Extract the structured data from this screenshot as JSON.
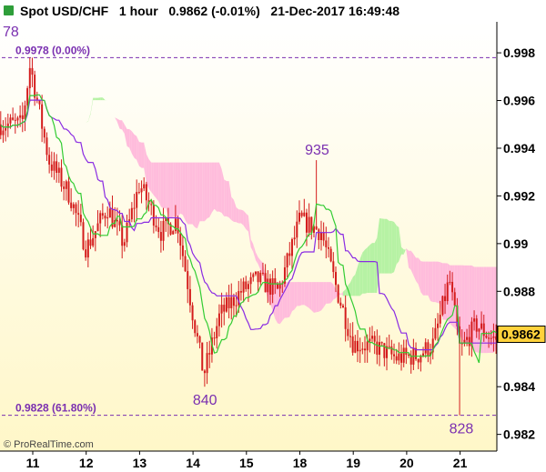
{
  "title": {
    "instrument": "Spot USD/CHF",
    "period": "1 hour",
    "last": "0.9862",
    "change": "(-0.01%)",
    "datetime": "21-Dec-2017 16:49:48"
  },
  "copyright": "© ProRealTime.com",
  "colors": {
    "candle": "#d41c1c",
    "tenkan": "#33cc33",
    "kijun": "#8a2be2",
    "kumo_bull": "#b6f2a4",
    "kumo_bear": "#ffbcdc",
    "background_top": "#ffffff",
    "background_bottom": "#fff7c8",
    "annotation": "#7a2fb0"
  },
  "chart_data": {
    "type": "candlestick",
    "x_ticks": [
      "11",
      "12",
      "13",
      "14",
      "15",
      "18",
      "19",
      "20",
      "21"
    ],
    "y_ticks": [
      "0.998",
      "0.996",
      "0.994",
      "0.992",
      "0.99",
      "0.988",
      "0.984",
      "0.982"
    ],
    "ylim": [
      0.9813,
      0.9993
    ],
    "last_price": 0.9862,
    "last_price_label": "0.9862",
    "levels": [
      {
        "value": 0.9978,
        "label": "0.9978 (0.00%)"
      },
      {
        "value": 0.9828,
        "label": "0.9828 (61.80%)"
      }
    ],
    "annotations": [
      {
        "text": "78",
        "price": 0.9978,
        "day_pos": 0.0
      },
      {
        "text": "935",
        "price": 0.9935,
        "day_pos": 5.3
      },
      {
        "text": "840",
        "price": 0.984,
        "day_pos": 3.2
      },
      {
        "text": "828",
        "price": 0.9828,
        "day_pos": 8.0
      }
    ],
    "key_points": [
      {
        "day_pos": -0.2,
        "close": 0.995
      },
      {
        "day_pos": -0.05,
        "close": 0.9975
      },
      {
        "day_pos": 0.3,
        "close": 0.9935
      },
      {
        "day_pos": 0.7,
        "close": 0.992
      },
      {
        "day_pos": 1.0,
        "close": 0.9898
      },
      {
        "day_pos": 1.4,
        "close": 0.9915
      },
      {
        "day_pos": 1.7,
        "close": 0.99
      },
      {
        "day_pos": 2.0,
        "close": 0.9925
      },
      {
        "day_pos": 2.4,
        "close": 0.9905
      },
      {
        "day_pos": 2.7,
        "close": 0.991
      },
      {
        "day_pos": 3.0,
        "close": 0.987
      },
      {
        "day_pos": 3.2,
        "close": 0.9845
      },
      {
        "day_pos": 3.5,
        "close": 0.987
      },
      {
        "day_pos": 3.9,
        "close": 0.988
      },
      {
        "day_pos": 4.2,
        "close": 0.9885
      },
      {
        "day_pos": 4.6,
        "close": 0.988
      },
      {
        "day_pos": 5.0,
        "close": 0.991
      },
      {
        "day_pos": 5.4,
        "close": 0.9905
      },
      {
        "day_pos": 5.7,
        "close": 0.988
      },
      {
        "day_pos": 6.0,
        "close": 0.9858
      },
      {
        "day_pos": 6.4,
        "close": 0.9857
      },
      {
        "day_pos": 6.8,
        "close": 0.9852
      },
      {
        "day_pos": 7.2,
        "close": 0.9853
      },
      {
        "day_pos": 7.5,
        "close": 0.9858
      },
      {
        "day_pos": 7.8,
        "close": 0.9885
      },
      {
        "day_pos": 8.0,
        "close": 0.9855
      },
      {
        "day_pos": 8.3,
        "close": 0.9866
      },
      {
        "day_pos": 8.6,
        "close": 0.986
      }
    ]
  }
}
